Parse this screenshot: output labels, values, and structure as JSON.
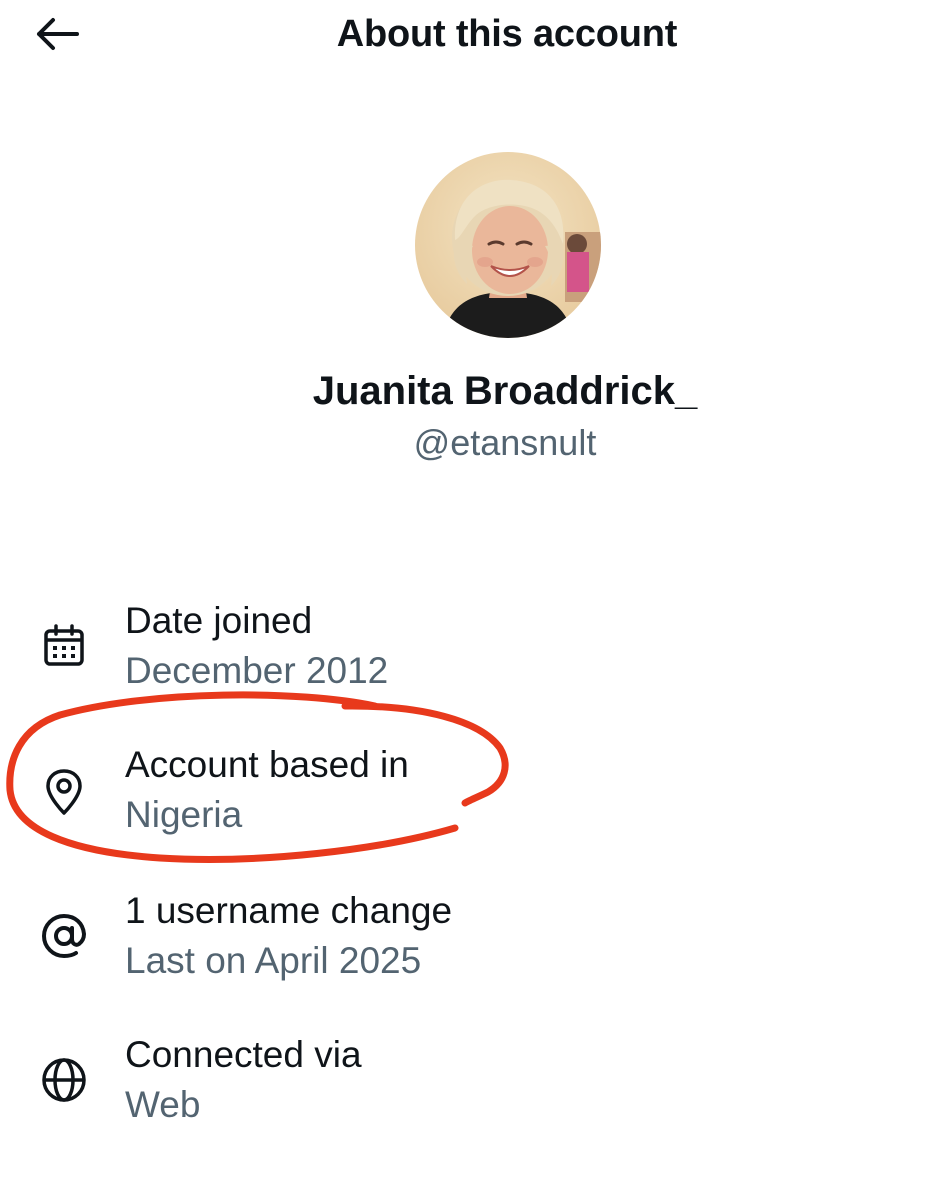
{
  "header": {
    "title": "About this account",
    "back_icon": "arrow-left-icon"
  },
  "profile": {
    "display_name": "Juanita Broaddrick_",
    "handle": "@etansnult"
  },
  "details": [
    {
      "icon": "calendar-icon",
      "title": "Date joined",
      "value": "December 2012"
    },
    {
      "icon": "location-pin-icon",
      "title": "Account based in",
      "value": "Nigeria"
    },
    {
      "icon": "at-sign-icon",
      "title": "1 username change",
      "value": "Last on April 2025"
    },
    {
      "icon": "globe-icon",
      "title": "Connected via",
      "value": "Web"
    }
  ],
  "colors": {
    "primary_text": "#0f1419",
    "secondary_text": "#536471",
    "annotation_circle": "#e8391c"
  }
}
